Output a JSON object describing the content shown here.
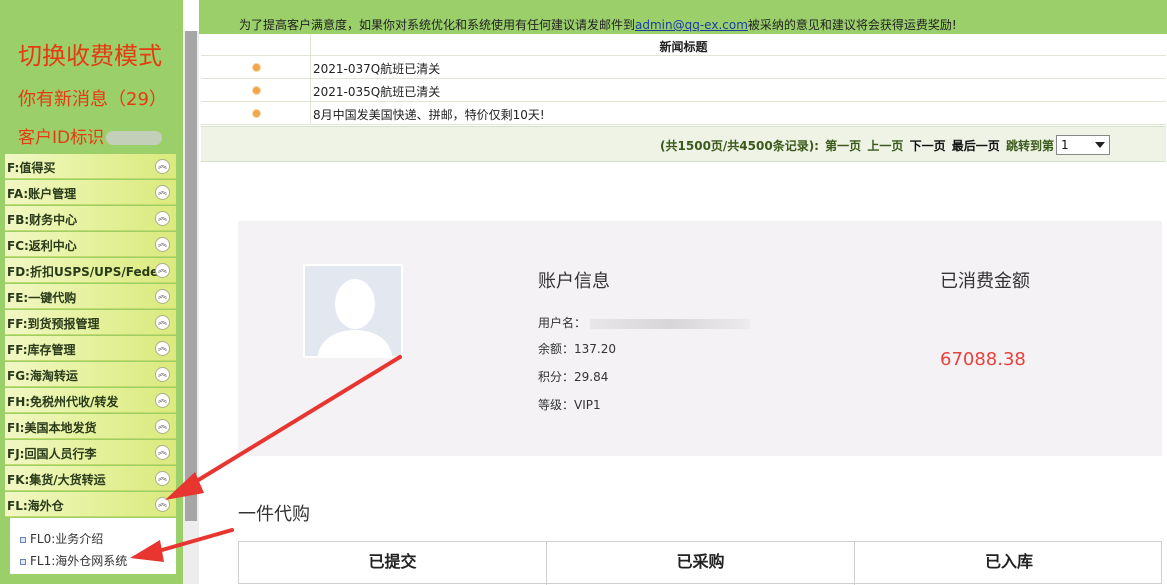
{
  "sidebar": {
    "switch_mode": "切换收费模式",
    "new_messages": "你有新消息（29）",
    "customer_id_label": "客户ID标识",
    "menu": [
      {
        "label": "F:值得买"
      },
      {
        "label": "FA:账户管理"
      },
      {
        "label": "FB:财务中心"
      },
      {
        "label": "FC:返利中心"
      },
      {
        "label": "FD:折扣USPS/UPS/Fedex"
      },
      {
        "label": "FE:一键代购"
      },
      {
        "label": "FF:到货预报管理"
      },
      {
        "label": "FF:库存管理"
      },
      {
        "label": "FG:海淘转运"
      },
      {
        "label": "FH:免税州代收/转发"
      },
      {
        "label": "FI:美国本地发货"
      },
      {
        "label": "FJ:回国人员行李"
      },
      {
        "label": "FK:集货/大货转运"
      },
      {
        "label": "FL:海外仓"
      }
    ],
    "submenu": [
      {
        "label": "FL0:业务介绍"
      },
      {
        "label": "FL1:海外仓网系统"
      }
    ],
    "toggle_glyph": "︽"
  },
  "notice": {
    "before": "为了提高客户满意度，如果你对系统优化和系统使用有任何建议请发邮件到",
    "email": "admin@qq-ex.com",
    "after": "被采纳的意见和建议将会获得运费奖励!"
  },
  "news": {
    "header": "新闻标题",
    "items": [
      {
        "title": "2021-037Q航班已清关"
      },
      {
        "title": "2021-035Q航班已清关"
      },
      {
        "title": "8月中国发美国快递、拼邮，特价仅剩10天!"
      }
    ]
  },
  "pager": {
    "summary": "(共1500页/共4500条记录):",
    "first": "第一页",
    "prev": "上一页",
    "next": "下一页",
    "last": "最后一页",
    "jump": "跳转到第",
    "selected_page": "1"
  },
  "account": {
    "title": "账户信息",
    "user_label": "用户名：",
    "balance": "余额：137.20",
    "points": "积分：29.84",
    "level": "等级：VIP1",
    "spent_title": "已消费金额",
    "spent_value": "67088.38"
  },
  "purchase": {
    "section_title": "一件代购",
    "columns": [
      "已提交",
      "已采购",
      "已入库"
    ]
  },
  "colors": {
    "sidebar_green": "#9acf6a",
    "accent_red": "#e83a12",
    "arrow_red": "#e8352f"
  }
}
